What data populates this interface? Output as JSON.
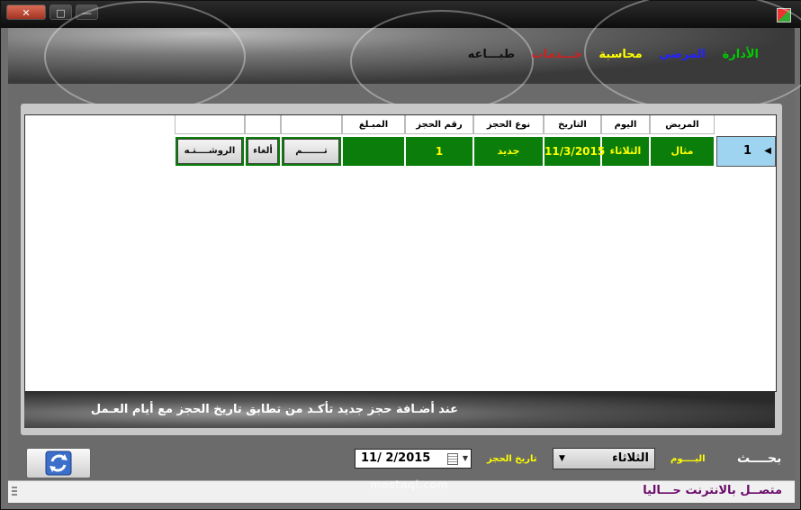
{
  "window": {
    "close_label": "✕",
    "maximize_label": "□",
    "minimize_label": "—"
  },
  "menu": {
    "items": [
      {
        "label": "الأدارة",
        "color": "#00cc00"
      },
      {
        "label": "المرضي",
        "color": "#2222ff"
      },
      {
        "label": "محاسبة",
        "color": "#ffff00"
      },
      {
        "label": "خـــدمات",
        "color": "#cc2222"
      },
      {
        "label": "طبـــاعه",
        "color": "#111111"
      }
    ]
  },
  "grid": {
    "columns": {
      "patient": "المريض",
      "day": "اليوم",
      "date": "التاريخ",
      "booking_type": "نوع الحجز",
      "booking_no": "رقم الحجز",
      "amount": "المبـلغ"
    },
    "row": {
      "index": "1",
      "patient": "مثال",
      "day": "الثلاثاء",
      "date": "11/3/2015",
      "booking_type": "جديد",
      "booking_no": "1",
      "amount": ""
    },
    "actions": {
      "done": "تـــــــم",
      "cancel": "ألغاء",
      "prescription": "الروشــــتـه"
    },
    "row_color": "#0a7d0a",
    "row_text_color": "#ffff00"
  },
  "notice": "عند أضـافة حجز جديد تأكـد من تطابق تاريخ الحجز مع  أيام العـمل",
  "filter": {
    "date_value": "11/  2/2015",
    "date_label": "تاريخ الحجز",
    "day_value": "الثلاثاء",
    "day_label": "اليــــوم",
    "search_label": "بحــــث"
  },
  "status": "متصــل بالانترنت حـــاليا",
  "watermark": "mostaql.com",
  "icons": {
    "refresh": "refresh-icon",
    "calendar": "calendar-icon"
  }
}
